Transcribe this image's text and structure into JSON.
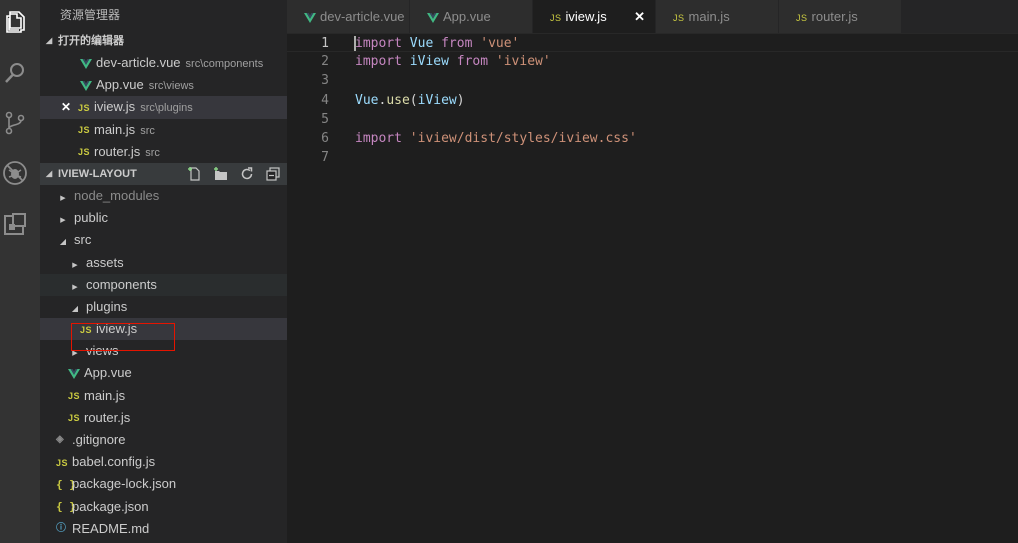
{
  "activity_bar": {
    "icons": [
      "explorer-icon",
      "search-icon",
      "source-control-icon",
      "debug-icon",
      "extensions-icon"
    ]
  },
  "sidebar": {
    "title": "资源管理器",
    "open_editors": {
      "header": "打开的编辑器",
      "items": [
        {
          "name": "dev-article.vue",
          "path": "src\\components",
          "icon": "vue"
        },
        {
          "name": "App.vue",
          "path": "src\\views",
          "icon": "vue"
        },
        {
          "name": "iview.js",
          "path": "src\\plugins",
          "icon": "js",
          "close": "✕"
        },
        {
          "name": "main.js",
          "path": "src",
          "icon": "js"
        },
        {
          "name": "router.js",
          "path": "src",
          "icon": "js"
        }
      ]
    },
    "workspace": {
      "header": "IVIEW-LAYOUT",
      "items": [
        {
          "name": "node_modules",
          "type": "folder"
        },
        {
          "name": "public",
          "type": "folder"
        },
        {
          "name": "src",
          "type": "folder-open"
        },
        {
          "name": "assets",
          "type": "folder"
        },
        {
          "name": "components",
          "type": "folder"
        },
        {
          "name": "plugins",
          "type": "folder-open"
        },
        {
          "name": "iview.js",
          "type": "js"
        },
        {
          "name": "views",
          "type": "folder"
        },
        {
          "name": "App.vue",
          "type": "vue"
        },
        {
          "name": "main.js",
          "type": "js"
        },
        {
          "name": "router.js",
          "type": "js"
        },
        {
          "name": ".gitignore",
          "type": "git"
        },
        {
          "name": "babel.config.js",
          "type": "js"
        },
        {
          "name": "package-lock.json",
          "type": "json"
        },
        {
          "name": "package.json",
          "type": "json"
        },
        {
          "name": "README.md",
          "type": "info"
        }
      ]
    }
  },
  "tabs": [
    {
      "label": "dev-article.vue",
      "icon": "vue"
    },
    {
      "label": "App.vue",
      "icon": "vue"
    },
    {
      "label": "iview.js",
      "icon": "js",
      "active": true,
      "close": "✕"
    },
    {
      "label": "main.js",
      "icon": "js"
    },
    {
      "label": "router.js",
      "icon": "js"
    }
  ],
  "editor": {
    "lines": [
      {
        "num": "1",
        "tokens": [
          [
            "kw",
            "import"
          ],
          [
            "plain",
            " "
          ],
          [
            "id",
            "Vue"
          ],
          [
            "plain",
            " "
          ],
          [
            "kw",
            "from"
          ],
          [
            "plain",
            " "
          ],
          [
            "str",
            "'vue'"
          ]
        ]
      },
      {
        "num": "2",
        "tokens": [
          [
            "kw",
            "import"
          ],
          [
            "plain",
            " "
          ],
          [
            "id",
            "iView"
          ],
          [
            "plain",
            " "
          ],
          [
            "kw",
            "from"
          ],
          [
            "plain",
            " "
          ],
          [
            "str",
            "'iview'"
          ]
        ]
      },
      {
        "num": "3",
        "tokens": []
      },
      {
        "num": "4",
        "tokens": [
          [
            "id",
            "Vue"
          ],
          [
            "plain",
            "."
          ],
          [
            "fn",
            "use"
          ],
          [
            "plain",
            "("
          ],
          [
            "id",
            "iView"
          ],
          [
            "plain",
            ")"
          ]
        ]
      },
      {
        "num": "5",
        "tokens": []
      },
      {
        "num": "6",
        "tokens": [
          [
            "kw",
            "import"
          ],
          [
            "plain",
            " "
          ],
          [
            "str",
            "'iview/dist/styles/iview.css'"
          ]
        ]
      },
      {
        "num": "7",
        "tokens": []
      }
    ]
  },
  "icons": {
    "js": "JS",
    "json": "{ }",
    "info": "ⓘ",
    "git": "◈"
  }
}
